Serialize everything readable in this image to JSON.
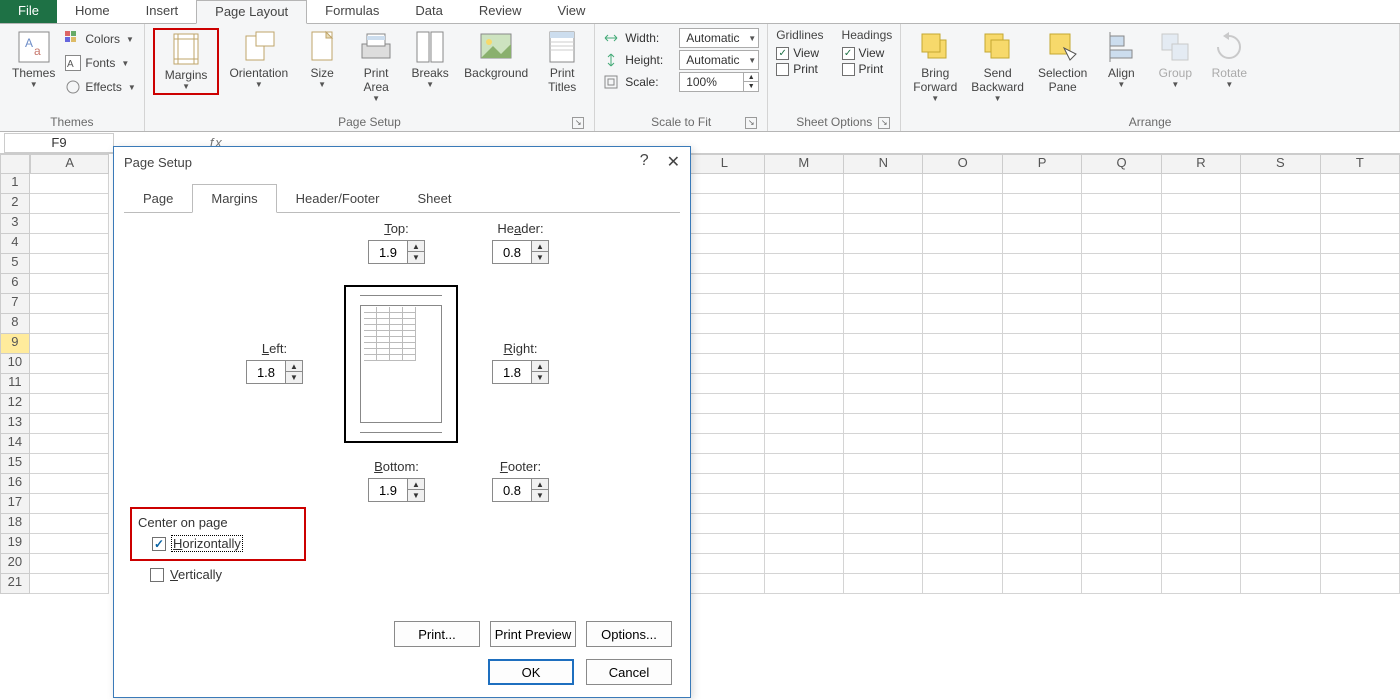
{
  "tabs": {
    "file": "File",
    "home": "Home",
    "insert": "Insert",
    "pageLayout": "Page Layout",
    "formulas": "Formulas",
    "data": "Data",
    "review": "Review",
    "view": "View",
    "active": "Page Layout"
  },
  "ribbon": {
    "themes": {
      "label": "Themes",
      "themes": "Themes",
      "colors": "Colors",
      "fonts": "Fonts",
      "effects": "Effects"
    },
    "pageSetup": {
      "label": "Page Setup",
      "margins": "Margins",
      "orientation": "Orientation",
      "size": "Size",
      "printArea": "Print\nArea",
      "breaks": "Breaks",
      "background": "Background",
      "printTitles": "Print\nTitles"
    },
    "scaleToFit": {
      "label": "Scale to Fit",
      "width": "Width:",
      "height": "Height:",
      "scale": "Scale:",
      "widthVal": "Automatic",
      "heightVal": "Automatic",
      "scaleVal": "100%"
    },
    "sheetOptions": {
      "label": "Sheet Options",
      "gridlines": "Gridlines",
      "headings": "Headings",
      "view": "View",
      "print": "Print",
      "gridView": true,
      "gridPrint": false,
      "headView": true,
      "headPrint": false
    },
    "arrange": {
      "label": "Arrange",
      "bringForward": "Bring\nForward",
      "sendBackward": "Send\nBackward",
      "selectionPane": "Selection\nPane",
      "align": "Align",
      "group": "Group",
      "rotate": "Rotate"
    }
  },
  "nameBox": "F9",
  "columns": [
    "A",
    "L",
    "M",
    "N",
    "O",
    "P",
    "Q",
    "R",
    "S",
    "T"
  ],
  "rowCount": 21,
  "selectedRow": 9,
  "dialog": {
    "title": "Page Setup",
    "tabs": {
      "page": "Page",
      "margins": "Margins",
      "headerFooter": "Header/Footer",
      "sheet": "Sheet",
      "active": "Margins"
    },
    "margins": {
      "topLabel": "Top:",
      "top": "1.9",
      "headerLabel": "Header:",
      "header": "0.8",
      "leftLabel": "Left:",
      "left": "1.8",
      "rightLabel": "Right:",
      "right": "1.8",
      "bottomLabel": "Bottom:",
      "bottom": "1.9",
      "footerLabel": "Footer:",
      "footer": "0.8"
    },
    "centerOnPage": {
      "title": "Center on page",
      "horizontally": "Horizontally",
      "vertically": "Vertically",
      "hChecked": true,
      "vChecked": false
    },
    "buttons": {
      "print": "Print...",
      "printPreview": "Print Preview",
      "options": "Options...",
      "ok": "OK",
      "cancel": "Cancel"
    }
  }
}
